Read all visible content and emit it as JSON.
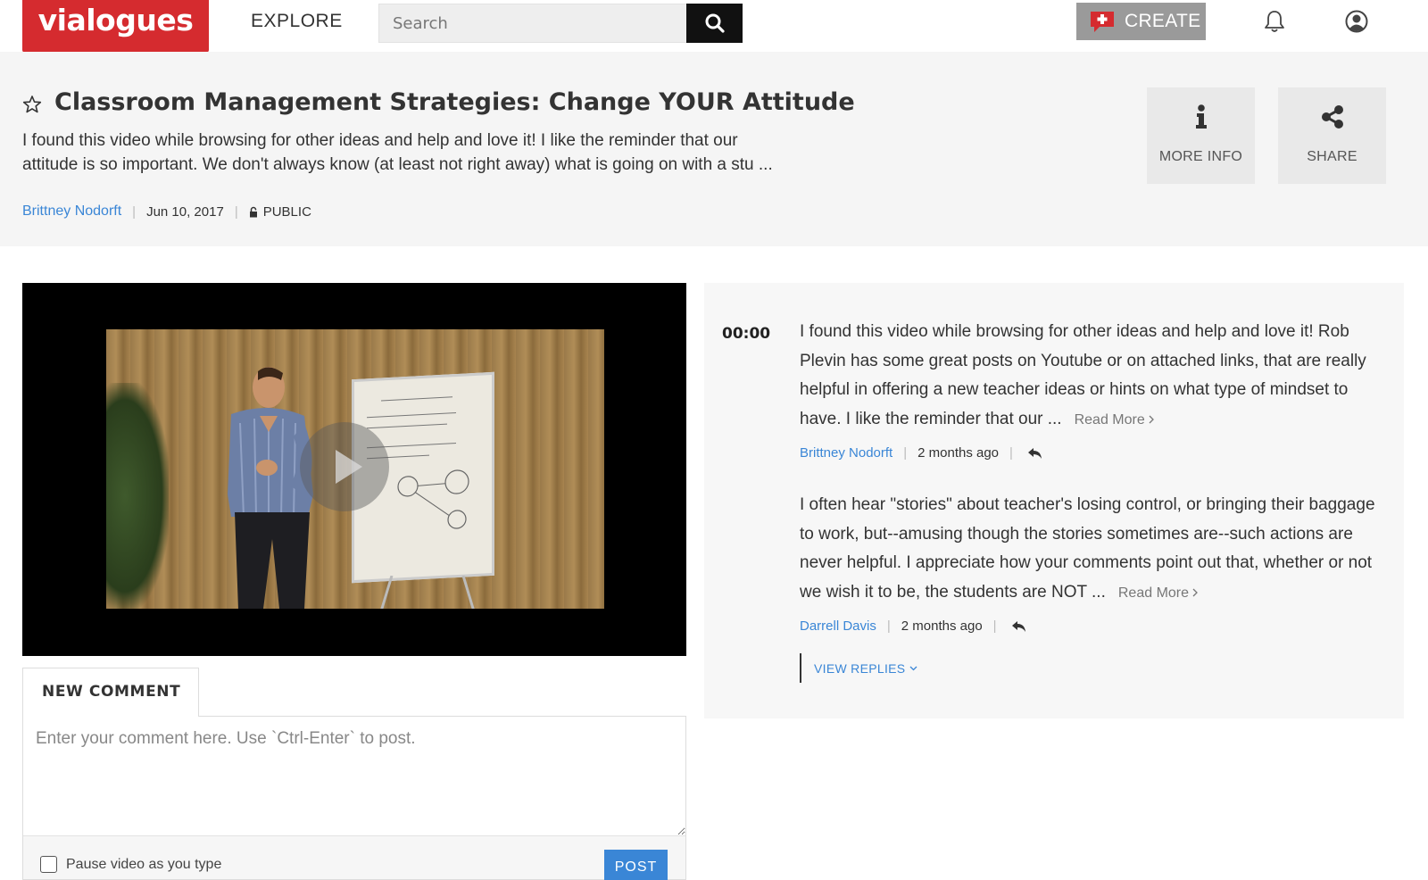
{
  "nav": {
    "logo": "vialogues",
    "explore": "EXPLORE",
    "search_placeholder": "Search",
    "create": "CREATE"
  },
  "header": {
    "title": "Classroom Management Strategies: Change YOUR Attitude",
    "description_line1": "I found this video while browsing for other ideas and help and love it! I like the reminder that our",
    "description_line2": "attitude is so important. We don't always know (at least not right away) what is going on with a stu ...",
    "author": "Brittney Nodorft",
    "date": "Jun 10, 2017",
    "visibility": "PUBLIC",
    "more_info": "MORE INFO",
    "share": "SHARE"
  },
  "composer": {
    "tab": "NEW COMMENT",
    "placeholder": "Enter your comment here. Use `Ctrl-Enter` to post.",
    "pause_label": "Pause video as you type",
    "post": "POST"
  },
  "comments": {
    "timestamp": "00:00",
    "items": [
      {
        "text": "I found this video while browsing for other ideas and help and love it! Rob Plevin has some great posts on Youtube or on attached links, that are really helpful in offering a new teacher ideas or hints on what type of mindset to have. I like the reminder that our ...",
        "read_more": "Read More",
        "author": "Brittney Nodorft",
        "time": "2 months ago"
      },
      {
        "text": "I often hear \"stories\" about teacher's losing control, or bringing their baggage to work, but--amusing though the stories sometimes are--such actions are never helpful. I appreciate how your comments point out that, whether or not we wish it to be, the students are NOT ...",
        "read_more": "Read More",
        "author": "Darrell Davis",
        "time": "2 months ago"
      }
    ],
    "view_replies": "VIEW REPLIES"
  },
  "colors": {
    "brand_red": "#d52b2f",
    "link_blue": "#3a86d6",
    "create_gray": "#9a9a9a"
  }
}
